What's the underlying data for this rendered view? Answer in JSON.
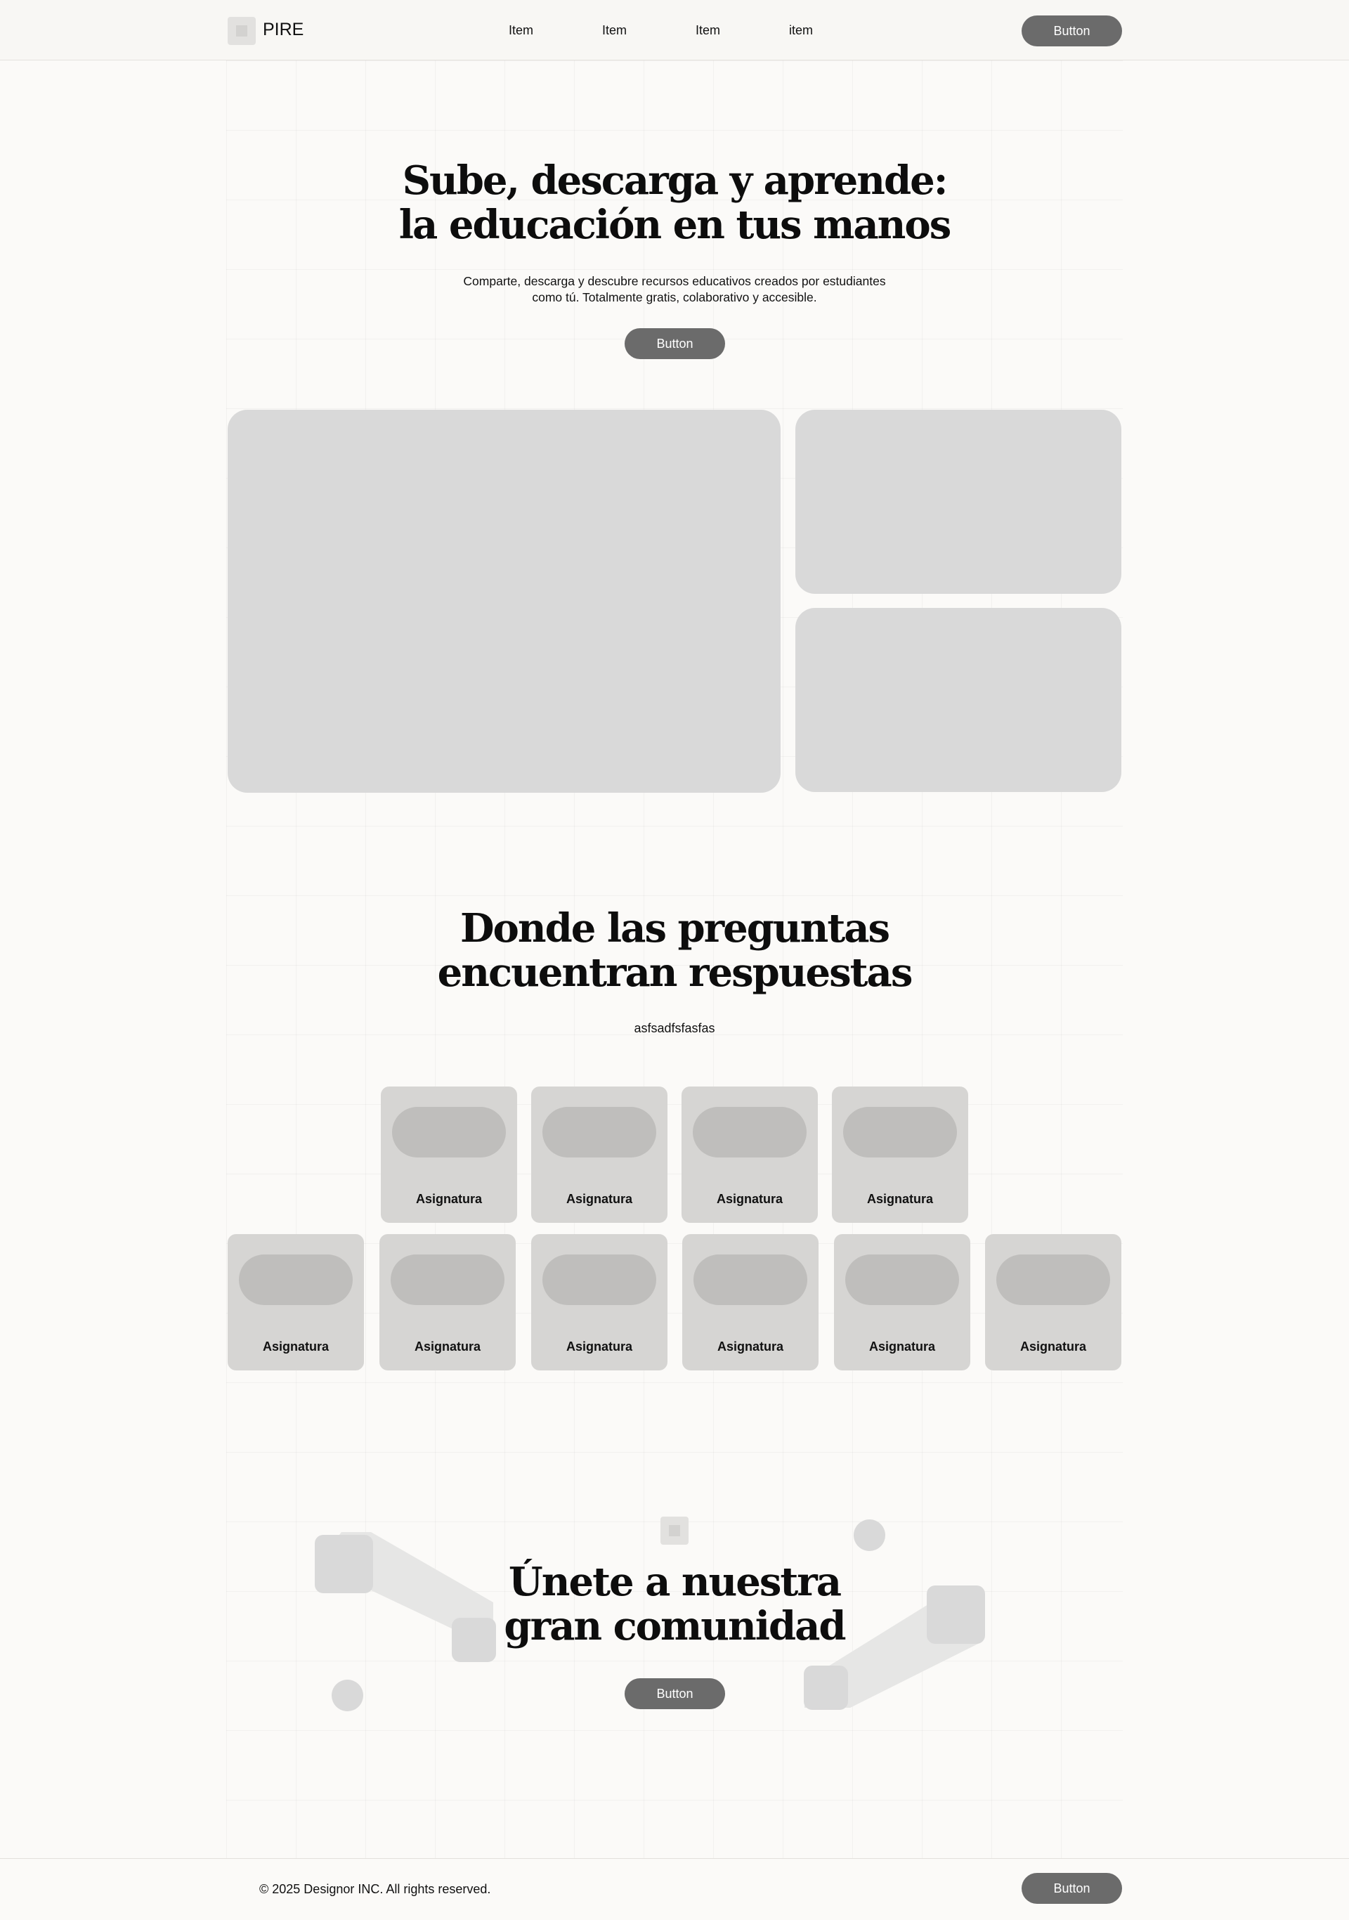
{
  "header": {
    "brand": "PIRE",
    "nav": [
      "Item",
      "Item",
      "Item",
      "item"
    ],
    "button_label": "Button"
  },
  "hero": {
    "title_line1": "Sube, descarga y aprende:",
    "title_line2": "la educación en tus manos",
    "subtitle_line1": "Comparte, descarga y descubre recursos educativos creados por estudiantes",
    "subtitle_line2": "como tú. Totalmente gratis, colaborativo y accesible.",
    "button_label": "Button"
  },
  "questions": {
    "title_line1": "Donde las preguntas",
    "title_line2": "encuentran respuestas",
    "subtitle": "asfsadfsfasfas",
    "subjects_row1": [
      "Asignatura",
      "Asignatura",
      "Asignatura",
      "Asignatura"
    ],
    "subjects_row2": [
      "Asignatura",
      "Asignatura",
      "Asignatura",
      "Asignatura",
      "Asignatura",
      "Asignatura"
    ]
  },
  "community": {
    "title_line1": "Únete a nuestra",
    "title_line2": "gran comunidad",
    "button_label": "Button"
  },
  "footer": {
    "copyright": "© 2025 Designor INC. All rights reserved.",
    "button_label": "Button"
  },
  "colors": {
    "background": "#fbfaf8",
    "button": "#6b6b6b",
    "placeholder": "#d9d9d9",
    "text": "#111111"
  }
}
